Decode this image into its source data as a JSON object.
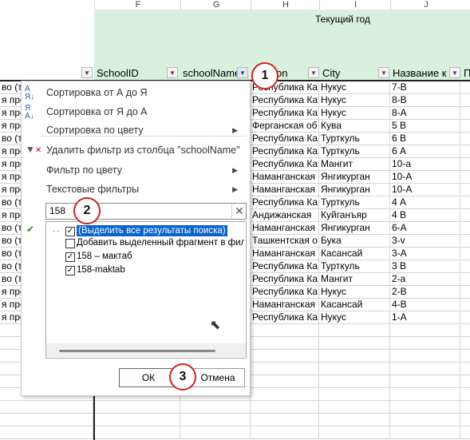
{
  "columns": [
    {
      "letter": "F"
    },
    {
      "letter": "G"
    },
    {
      "letter": "H"
    },
    {
      "letter": "I"
    },
    {
      "letter": "J"
    }
  ],
  "group_header": "Текущий год",
  "header_row": {
    "col_f": "SchoolID",
    "col_g": "schoolName",
    "col_h": "on",
    "col_i": "City",
    "col_j": "Название к",
    "col_k": "П"
  },
  "left_col_text": [
    "во (т",
    "я про",
    "я про",
    "я про",
    "во (т",
    "я про",
    "я про",
    "я про",
    "я про",
    "во (т",
    "я про",
    "во (т",
    "во (т",
    "во (т",
    "во (т",
    "во (т",
    "я про",
    "я про",
    "я про"
  ],
  "rows": [
    {
      "region": "Республика Ка",
      "city": "Нукус",
      "cls": "7-В"
    },
    {
      "region": "Республика Ка",
      "city": "Нукус",
      "cls": "8-В"
    },
    {
      "region": "Республика Ка",
      "city": "Нукус",
      "cls": "8-А"
    },
    {
      "region": "Ферганская об",
      "city": "Кува",
      "cls": "5 В"
    },
    {
      "region": "Республика Ка",
      "city": "Турткуль",
      "cls": "6 В"
    },
    {
      "region": "Республика Ка",
      "city": "Турткуль",
      "cls": "6 А"
    },
    {
      "region": "Республика Ка",
      "city": "Мангит",
      "cls": "10-а"
    },
    {
      "region": "Наманганская",
      "city": "Янгикурган",
      "cls": "10-А"
    },
    {
      "region": "Наманганская",
      "city": "Янгикурган",
      "cls": "10-А"
    },
    {
      "region": "Республика Ка",
      "city": "Турткуль",
      "cls": "4 А"
    },
    {
      "region": "Андижанская",
      "city": "Куйганъяр",
      "cls": "4 В"
    },
    {
      "region": "Наманганская",
      "city": "Янгикурган",
      "cls": "6-А"
    },
    {
      "region": "Ташкентская о",
      "city": "Бука",
      "cls": "3-v"
    },
    {
      "region": "Наманганская",
      "city": "Касансай",
      "cls": "3-А"
    },
    {
      "region": "Республика Ка",
      "city": "Турткуль",
      "cls": "3 В"
    },
    {
      "region": "Республика Ка",
      "city": "Мангит",
      "cls": "2-а"
    },
    {
      "region": "Республика Ка",
      "city": "Нукус",
      "cls": "2-В"
    },
    {
      "region": "Наманганская",
      "city": "Касансай",
      "cls": "4-В"
    },
    {
      "region": "Республика Ка",
      "city": "Нукус",
      "cls": "1-А"
    }
  ],
  "menu": {
    "sort_az": "Сортировка от А до Я",
    "sort_za": "Сортировка от Я до А",
    "sort_color": "Сортировка по цвету",
    "remove_filter": "Удалить фильтр из столбца \"schoolName\"",
    "filter_color": "Фильтр по цвету",
    "text_filters": "Текстовые фильтры",
    "search_value": "158",
    "list": [
      {
        "label": "(Выделить все результаты поиска)",
        "checked": true
      },
      {
        "label": "Добавить выделенный фрагмент в фил",
        "checked": false
      },
      {
        "label": "158 – мактаб",
        "checked": true
      },
      {
        "label": "158-maktab",
        "checked": true
      }
    ],
    "ok": "ОК",
    "cancel": "Отмена"
  },
  "badges": [
    "1",
    "2",
    "3"
  ],
  "colors": {
    "header_green": "#d9f0dd",
    "badge_red": "#d32020",
    "selection_blue": "#0a64c8"
  }
}
